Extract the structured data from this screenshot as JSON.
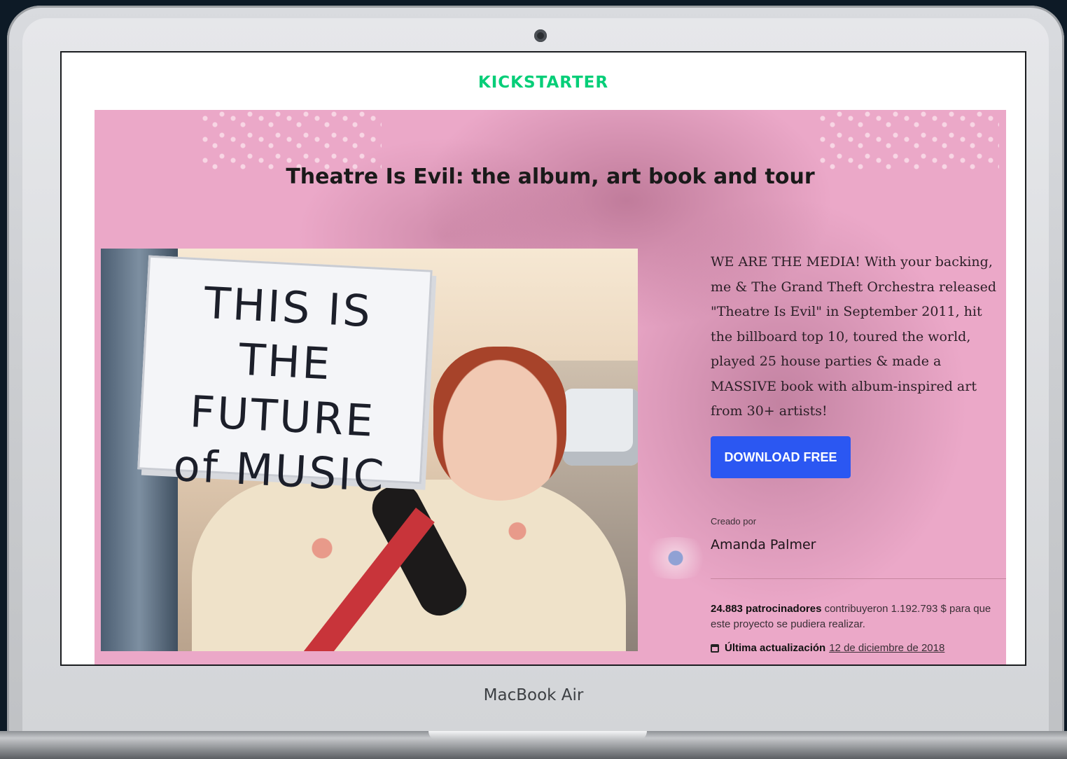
{
  "device": {
    "label": "MacBook Air"
  },
  "page": {
    "logo": "KICKSTARTER",
    "title": "Theatre Is Evil: the album, art book and tour",
    "image": {
      "sign_lines": [
        "THIS IS",
        "THE FUTURE",
        "of MUSIC"
      ]
    },
    "blurb": "WE ARE THE MEDIA! With your backing, me & The Grand Theft Orchestra released \"Theatre Is Evil\" in September 2011, hit the billboard top 10, toured the world, played 25 house parties & made a MASSIVE book with album-inspired art from 30+ artists!",
    "cta_label": "DOWNLOAD FREE",
    "created_by_label": "Creado por",
    "creator_name": "Amanda Palmer",
    "funding": {
      "backers": "24.883 patrocinadores",
      "rest": " contribuyeron 1.192.793 $ para que este proyecto se pudiera realizar."
    },
    "update": {
      "icon": "calendar-icon",
      "label": "Última actualización",
      "date": "12 de diciembre de 2018"
    }
  },
  "colors": {
    "brand": "#05ce78",
    "cta": "#2b57f2",
    "hero_background": "#eba8c8"
  }
}
